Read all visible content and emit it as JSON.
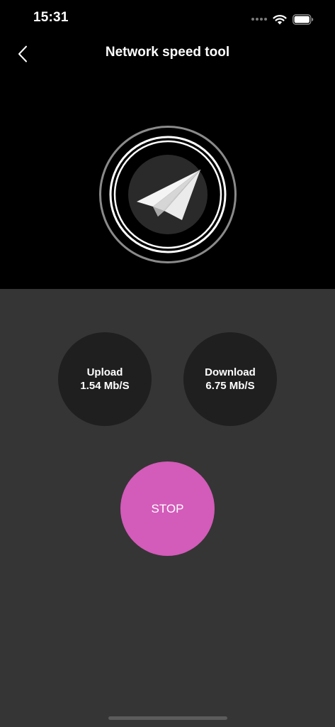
{
  "status_bar": {
    "time": "15:31",
    "icons": [
      "cellular-dots-icon",
      "wifi-icon",
      "battery-icon"
    ]
  },
  "nav": {
    "back_icon": "chevron-left-icon",
    "title": "Network speed tool"
  },
  "hero": {
    "icon": "paper-plane-icon"
  },
  "stats": {
    "upload": {
      "label": "Upload",
      "value": "1.54 Mb/S"
    },
    "download": {
      "label": "Download",
      "value": "6.75 Mb/S"
    }
  },
  "actions": {
    "stop_label": "STOP"
  },
  "colors": {
    "top_background": "#000000",
    "bottom_background": "#353535",
    "stat_circle": "#1f1f1f",
    "accent": "#d35bb9"
  }
}
